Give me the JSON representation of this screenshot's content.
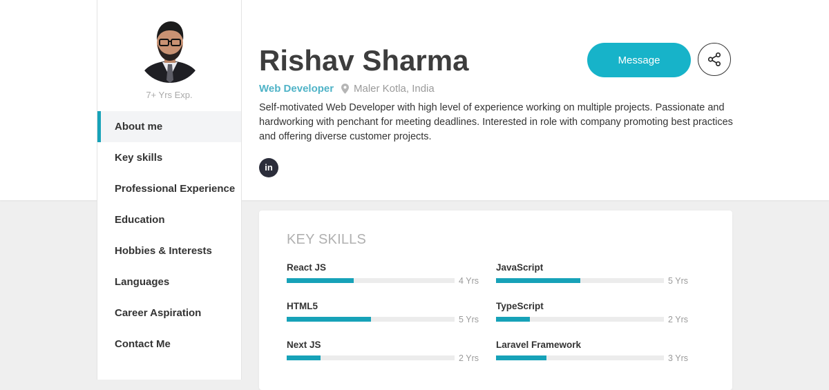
{
  "profile": {
    "experience": "7+ Yrs Exp.",
    "name": "Rishav Sharma",
    "role": "Web Developer",
    "location": "Maler Kotla, India",
    "bio": "Self-motivated Web Developer with high level of experience working on multiple projects. Passionate and hardworking with penchant for meeting deadlines. Interested in role with company promoting best practices and offering diverse customer projects.",
    "linkedin_icon": "in"
  },
  "actions": {
    "message_label": "Message",
    "share_icon": "share-icon"
  },
  "nav": {
    "items": [
      {
        "label": "About me",
        "active": true
      },
      {
        "label": "Key skills",
        "active": false
      },
      {
        "label": "Professional Experience",
        "active": false
      },
      {
        "label": "Education",
        "active": false
      },
      {
        "label": "Hobbies & Interests",
        "active": false
      },
      {
        "label": "Languages",
        "active": false
      },
      {
        "label": "Career Aspiration",
        "active": false
      },
      {
        "label": "Contact Me",
        "active": false
      }
    ]
  },
  "skills": {
    "title": "KEY SKILLS",
    "items": [
      {
        "name": "React JS",
        "years": "4 Yrs",
        "level": 0.4
      },
      {
        "name": "JavaScript",
        "years": "5 Yrs",
        "level": 0.5
      },
      {
        "name": "HTML5",
        "years": "5 Yrs",
        "level": 0.5
      },
      {
        "name": "TypeScript",
        "years": "2 Yrs",
        "level": 0.2
      },
      {
        "name": "Next JS",
        "years": "2 Yrs",
        "level": 0.2
      },
      {
        "name": "Laravel Framework",
        "years": "3 Yrs",
        "level": 0.3
      }
    ]
  },
  "colors": {
    "accent": "#17a2b8",
    "button": "#17b3c9",
    "role_text": "#4fb3c7"
  }
}
